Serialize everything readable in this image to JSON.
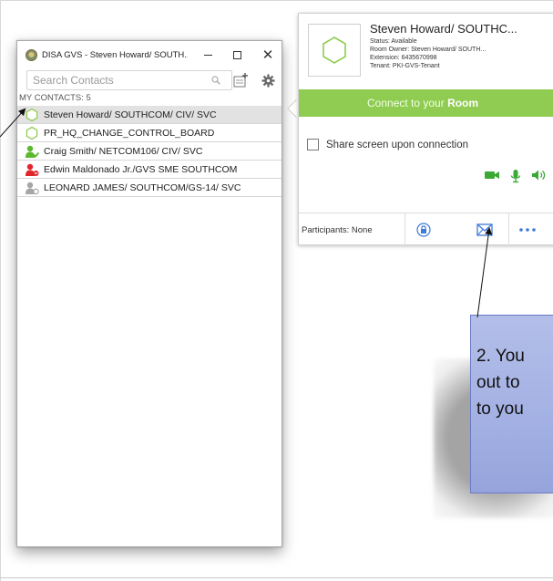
{
  "window": {
    "title": "DISA GVS - Steven Howard/ SOUTH...",
    "minimize_icon": "minimize-icon",
    "maximize_icon": "maximize-icon",
    "close_label": "✕"
  },
  "search": {
    "placeholder": "Search Contacts",
    "icon": "search-icon"
  },
  "contacts": {
    "header": "MY CONTACTS: 5",
    "items": [
      {
        "name": "Steven Howard/ SOUTHCOM/ CIV/ SVC",
        "status": "room-hexagon",
        "selected": true
      },
      {
        "name": "PR_HQ_CHANGE_CONTROL_BOARD",
        "status": "room-hexagon"
      },
      {
        "name": "Craig Smith/ NETCOM106/ CIV/ SVC",
        "status": "online",
        "color": "#5cb82e"
      },
      {
        "name": "Edwin Maldonado Jr./GVS SME SOUTHCOM",
        "status": "busy",
        "color": "#e0262b"
      },
      {
        "name": "LEONARD JAMES/ SOUTHCOM/GS-14/ SVC",
        "status": "offline",
        "color": "#a6a6a6"
      }
    ]
  },
  "room": {
    "name": "Steven Howard/ SOUTHC...",
    "status": "Status: Available",
    "owner": "Room Owner: Steven Howard/ SOUTH...",
    "extension": "Extension: 6435670998",
    "tenant": "Tenant: PKI-GVS-Tenant",
    "connect_prefix": "Connect to your",
    "connect_bold": "Room",
    "share_label": "Share screen upon connection",
    "participants": "Participants: None"
  },
  "callout": {
    "lines": [
      "2. You",
      "out to",
      "to you"
    ]
  },
  "colors": {
    "accent_green": "#8fcc51",
    "media_green": "#3aa935",
    "footer_blue": "#3e7bd6",
    "callout_fill": "#a3b0e3"
  }
}
